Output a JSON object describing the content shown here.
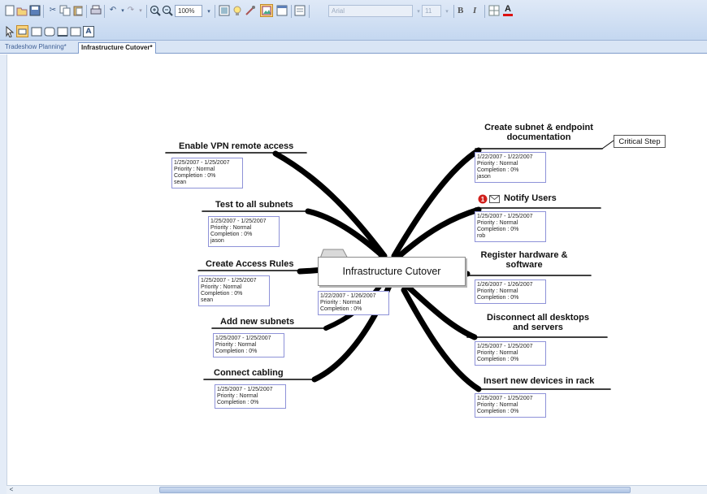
{
  "toolbar": {
    "zoom": "100%",
    "font_name": "Arial",
    "font_size": "11",
    "bold_label": "B",
    "italic_label": "I",
    "font_color_label": "A"
  },
  "tabs": [
    {
      "label": "Tradeshow Planning*",
      "active": false
    },
    {
      "label": "Infrastructure Cutover*",
      "active": true
    }
  ],
  "map": {
    "central": {
      "title": "Infrastructure Cutover",
      "info": [
        "1/22/2007 - 1/26/2007",
        "Priority : Normal",
        "Completion : 0%"
      ]
    },
    "callout": "Critical Step",
    "left_topics": [
      {
        "title": "Enable VPN remote access",
        "info": [
          "1/25/2007 - 1/25/2007",
          "Priority : Normal",
          "Completion : 0%",
          "sean"
        ]
      },
      {
        "title": "Test to all subnets",
        "info": [
          "1/25/2007 - 1/25/2007",
          "Priority : Normal",
          "Completion : 0%",
          "jason"
        ]
      },
      {
        "title": "Create Access Rules",
        "info": [
          "1/25/2007 - 1/25/2007",
          "Priority : Normal",
          "Completion : 0%",
          "sean"
        ]
      },
      {
        "title": "Add new subnets",
        "info": [
          "1/25/2007 - 1/25/2007",
          "Priority : Normal",
          "Completion : 0%"
        ]
      },
      {
        "title": "Connect cabling",
        "info": [
          "1/25/2007 - 1/25/2007",
          "Priority : Normal",
          "Completion : 0%"
        ]
      }
    ],
    "right_topics": [
      {
        "title_lines": [
          "Create subnet & endpoint",
          "documentation"
        ],
        "info": [
          "1/22/2007 - 1/22/2007",
          "Priority : Normal",
          "Completion : 0%",
          "jason"
        ]
      },
      {
        "title_lines": [
          "Notify Users"
        ],
        "info": [
          "1/25/2007 - 1/25/2007",
          "Priority : Normal",
          "Completion : 0%",
          "rob"
        ]
      },
      {
        "title_lines": [
          "Register hardware &",
          "software"
        ],
        "info": [
          "1/26/2007 - 1/26/2007",
          "Priority : Normal",
          "Completion : 0%"
        ]
      },
      {
        "title_lines": [
          "Disconnect all desktops",
          "and servers"
        ],
        "info": [
          "1/25/2007 - 1/25/2007",
          "Priority : Normal",
          "Completion : 0%"
        ]
      },
      {
        "title_lines": [
          "Insert new devices in rack"
        ],
        "info": [
          "1/25/2007 - 1/25/2007",
          "Priority : Normal",
          "Completion : 0%"
        ]
      }
    ],
    "notify_icons": [
      "priority-1-icon",
      "envelope-icon"
    ]
  },
  "scrollbar": {
    "left_arrow": "<"
  }
}
